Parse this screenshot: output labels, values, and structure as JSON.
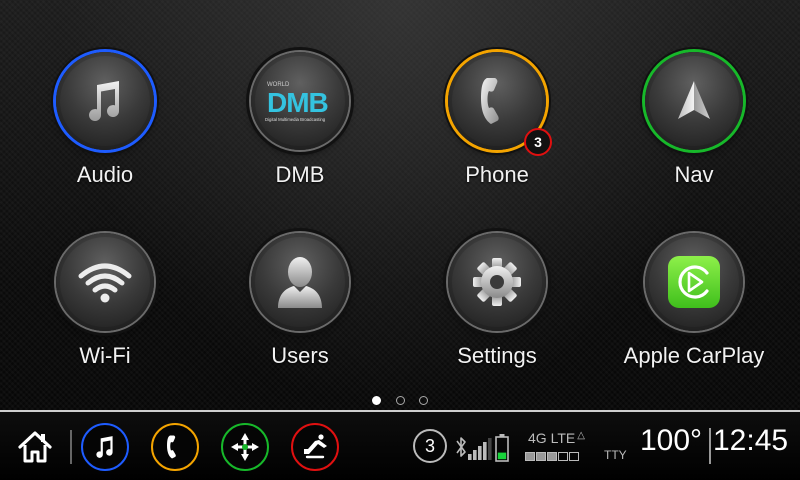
{
  "apps": [
    {
      "label": "Audio",
      "icon": "music-note-icon",
      "ring": "#1e5cff"
    },
    {
      "label": "DMB",
      "icon": "dmb-logo-icon",
      "ring": "#6a6a6a",
      "logo": {
        "top": "WORLD",
        "main": "DMB",
        "sub": "Digital Multimedia Broadcasting"
      }
    },
    {
      "label": "Phone",
      "icon": "phone-icon",
      "ring": "#f4a400",
      "badge": "3"
    },
    {
      "label": "Nav",
      "icon": "navigation-arrow-icon",
      "ring": "#17b82a"
    },
    {
      "label": "Wi-Fi",
      "icon": "wifi-icon",
      "ring": "#6a6a6a"
    },
    {
      "label": "Users",
      "icon": "user-silhouette-icon",
      "ring": "#6a6a6a"
    },
    {
      "label": "Settings",
      "icon": "gear-icon",
      "ring": "#6a6a6a"
    },
    {
      "label": "Apple CarPlay",
      "icon": "carplay-icon",
      "ring": "#6a6a6a"
    }
  ],
  "pagination": {
    "pages": 3,
    "current": 1
  },
  "bottom_bar": {
    "quick_buttons": [
      {
        "icon": "music-note-icon",
        "color": "#1e5cff"
      },
      {
        "icon": "phone-icon",
        "color": "#f4a400"
      },
      {
        "icon": "navigation-compass-icon",
        "color": "#17b82a"
      },
      {
        "icon": "seat-climate-icon",
        "color": "#e01010"
      }
    ],
    "notification_count": "3",
    "network_label": "4G LTE",
    "signal_bars_on": 4,
    "signal_bars_total": 5,
    "battery_level": 0.3,
    "tty_label": "TTY",
    "temperature": "100°",
    "time": "12:45"
  }
}
